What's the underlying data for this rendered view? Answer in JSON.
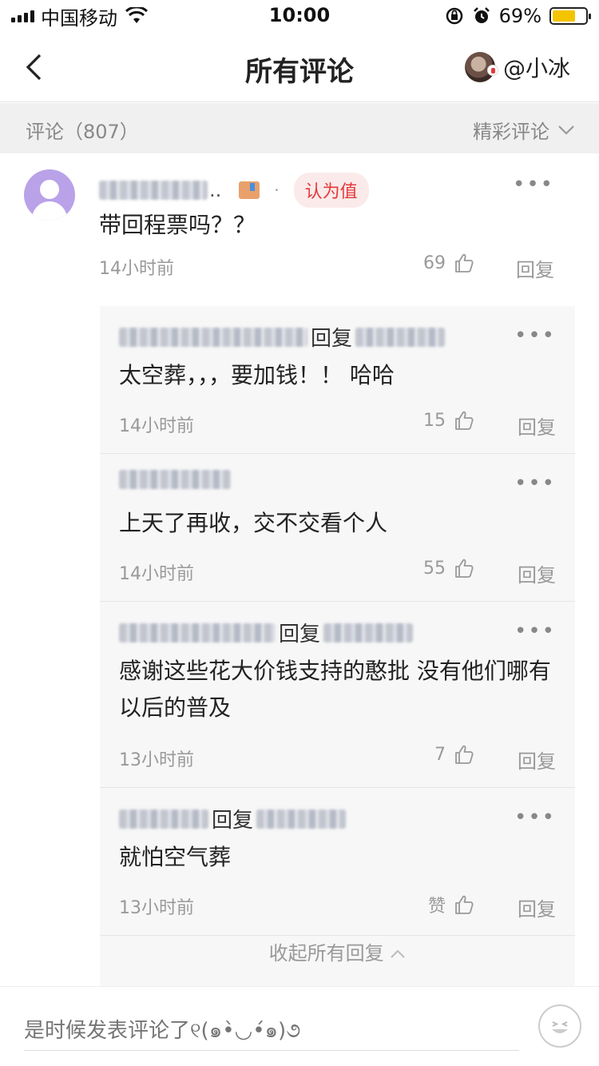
{
  "status_bar": {
    "carrier": "中国移动",
    "time": "10:00",
    "battery_pct": "69%",
    "battery_level": 0.69
  },
  "nav": {
    "title": "所有评论",
    "username": "@小冰"
  },
  "comments_header": {
    "count_label": "评论（807）",
    "sort_label": "精彩评论"
  },
  "main_comment": {
    "name_suffix": "..",
    "badge": "认为值",
    "text": "带回程票吗？？",
    "time": "14小时前",
    "likes": "69",
    "reply_label": "回复"
  },
  "replies": [
    {
      "reply_word": "回复",
      "text": "太空葬，，，要加钱！！ 哈哈",
      "time": "14小时前",
      "likes": "15",
      "reply_label": "回复"
    },
    {
      "reply_word": "",
      "text": "上天了再收，交不交看个人",
      "time": "14小时前",
      "likes": "55",
      "reply_label": "回复"
    },
    {
      "reply_word": "回复",
      "text": "感谢这些花大价钱支持的憨批 没有他们哪有以后的普及",
      "time": "13小时前",
      "likes": "7",
      "reply_label": "回复"
    },
    {
      "reply_word": "回复",
      "text": "就怕空气葬",
      "time": "13小时前",
      "likes": "赞",
      "reply_label": "回复"
    }
  ],
  "collapse_label": "收起所有回复",
  "input": {
    "placeholder": "是时候发表评论了୧(๑•̀◡•́๑)૭"
  }
}
